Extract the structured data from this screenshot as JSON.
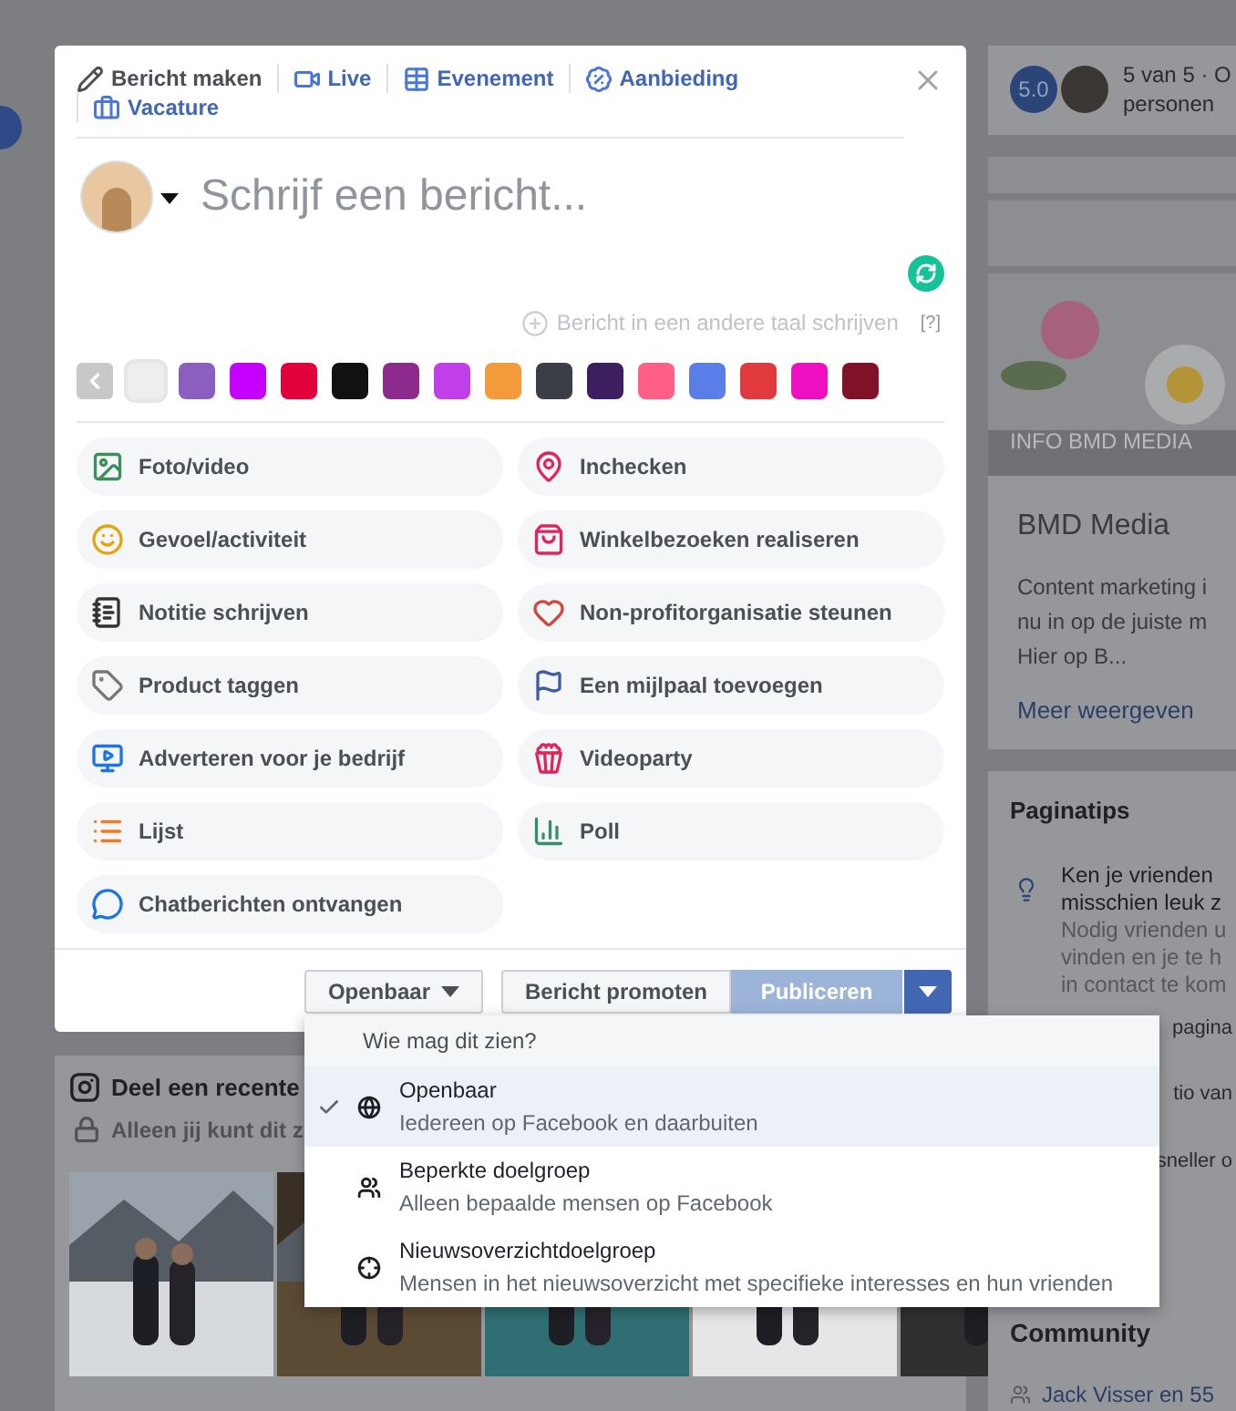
{
  "composer": {
    "tabs": [
      {
        "label": "Bericht maken",
        "selected": true
      },
      {
        "label": "Live",
        "selected": false
      },
      {
        "label": "Evenement",
        "selected": false
      },
      {
        "label": "Aanbieding",
        "selected": false
      },
      {
        "label": "Vacature",
        "selected": false
      }
    ],
    "placeholder": "Schrijf een bericht...",
    "translate_link": "Bericht in een andere taal schrijven",
    "help_link": "[?]",
    "backgrounds": [
      {
        "color": "#eeeeee",
        "selected": true
      },
      {
        "color": "#8a5fbf",
        "selected": false
      },
      {
        "color": "#c600ff",
        "selected": false
      },
      {
        "color": "#e2013b",
        "selected": false
      },
      {
        "color": "#111111",
        "selected": false
      },
      {
        "color": "#8c2b8c",
        "selected": false
      },
      {
        "color": "#c13fe8",
        "selected": false
      },
      {
        "color": "#f39a3b",
        "selected": false
      },
      {
        "color": "#3b3e46",
        "selected": false
      },
      {
        "color": "#3d1e5e",
        "selected": false
      },
      {
        "color": "#ff5f86",
        "selected": false
      },
      {
        "color": "#5a7de8",
        "selected": false
      },
      {
        "color": "#e0393e",
        "selected": false
      },
      {
        "color": "#ee10c0",
        "selected": false
      },
      {
        "color": "#7f1228",
        "selected": false
      }
    ],
    "actions": [
      "Foto/video",
      "Inchecken",
      "Gevoel/activiteit",
      "Winkelbezoeken realiseren",
      "Notitie schrijven",
      "Non-profitorganisatie steunen",
      "Product taggen",
      "Een mijlpaal toevoegen",
      "Adverteren voor je bedrijf",
      "Videoparty",
      "Lijst",
      "Poll",
      "Chatberichten ontvangen"
    ],
    "privacy_button": "Openbaar",
    "promote_button": "Bericht promoten",
    "publish_button": {
      "label": "Publiceren",
      "disabled": true
    }
  },
  "audience_menu": {
    "title": "Wie mag dit zien?",
    "options": [
      {
        "title": "Openbaar",
        "description": "Iedereen op Facebook en daarbuiten",
        "selected": true
      },
      {
        "title": "Beperkte doelgroep",
        "description": "Alleen bepaalde mensen op Facebook",
        "selected": false
      },
      {
        "title": "Nieuwsoverzichtdoelgroep",
        "description": "Mensen in het nieuwsoverzicht met specifieke interesses en hun vrienden",
        "selected": false
      }
    ]
  },
  "page_behind": {
    "rating": {
      "score": "5.0",
      "text": "5 van 5 · O",
      "subtext": "personen"
    },
    "page_card": {
      "image_caption": "INFO BMD MEDIA",
      "name": "BMD Media",
      "lines": [
        "Content marketing i",
        "nu in op de juiste m",
        "Hier op B..."
      ],
      "link": "Meer weergeven"
    },
    "tips": {
      "title": "Paginatips",
      "lines": [
        "Ken je vrienden",
        "misschien leuk z"
      ],
      "sublines": [
        "Nodig vrienden u",
        "vinden en je te h",
        "in contact te kom"
      ]
    },
    "partial_texts": [
      "pagina",
      "tio van",
      "sneller o"
    ],
    "community": {
      "title": "Community",
      "line": "Jack Visser en 55"
    },
    "instagram": {
      "title": "Deel een recente",
      "subtitle": "Alleen jij kunt dit z"
    }
  }
}
